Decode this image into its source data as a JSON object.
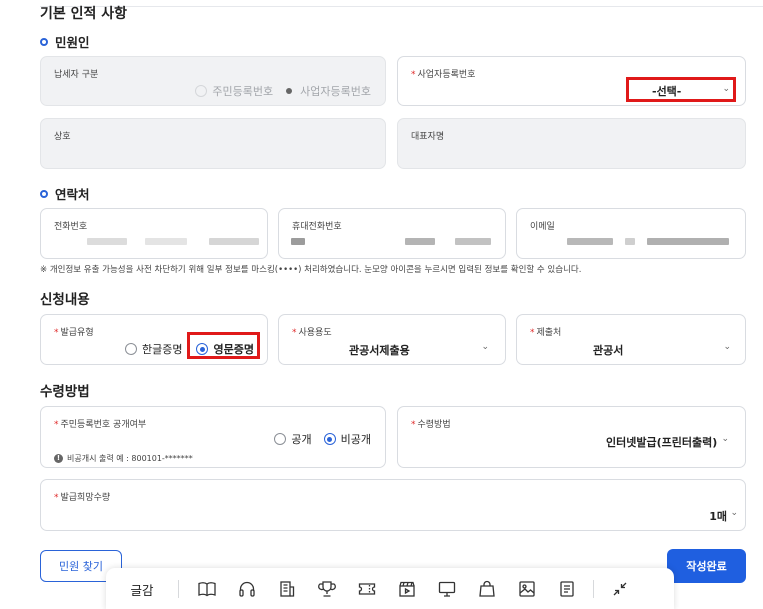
{
  "section_title": "기본 인적 사항",
  "applicant": {
    "title": "민원인",
    "taxpayer_type": {
      "label": "납세자 구분",
      "options": [
        "주민등록번호",
        "사업자등록번호"
      ],
      "selected": "사업자등록번호"
    },
    "business_number": {
      "label": "사업자등록번호",
      "value": "-선택-"
    },
    "company_name": {
      "label": "상호"
    },
    "representative": {
      "label": "대표자명"
    }
  },
  "contact": {
    "title": "연락처",
    "phone": {
      "label": "전화번호"
    },
    "mobile": {
      "label": "휴대전화번호"
    },
    "email": {
      "label": "이메일"
    },
    "privacy_note": "※ 개인정보 유출 가능성을 사전 차단하기 위해 일부 정보를 마스킹(••••) 처리하였습니다. 눈모양 아이콘을 누르시면 입력된 정보를 확인할 수 있습니다."
  },
  "application": {
    "title": "신청내용",
    "issue_type": {
      "label": "발급유형",
      "options": [
        "한글증명",
        "영문증명"
      ],
      "selected": "영문증명"
    },
    "purpose": {
      "label": "사용용도",
      "value": "관공서제출용"
    },
    "submit_to": {
      "label": "제출처",
      "value": "관공서"
    }
  },
  "receipt": {
    "title": "수령방법",
    "id_disclosure": {
      "label": "주민등록번호 공개여부",
      "options": [
        "공개",
        "비공개"
      ],
      "selected": "비공개",
      "hint": "비공개시 출력 예 : 800101-*******"
    },
    "method": {
      "label": "수령방법",
      "value": "인터넷발급(프린터출력)"
    },
    "quantity": {
      "label": "발급희망수량",
      "value": "1매"
    }
  },
  "buttons": {
    "find": "민원 찾기",
    "complete": "작성완료"
  },
  "toolbar": {
    "label": "글감",
    "icons": [
      "book-icon",
      "headphones-icon",
      "building-icon",
      "trophy-icon",
      "ticket-icon",
      "clapper-icon",
      "monitor-icon",
      "shopping-bag-icon",
      "image-icon",
      "document-icon",
      "collapse-icon"
    ]
  },
  "colors": {
    "accent": "#1f5fe0",
    "required": "#e02b2b",
    "highlight": "#e01919"
  }
}
